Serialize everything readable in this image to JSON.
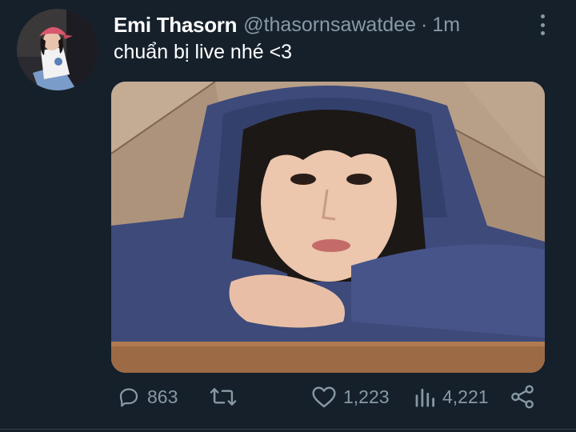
{
  "tweet": {
    "author_name": "Emi Thasorn",
    "handle": "@thasornsawatdee",
    "separator": "·",
    "time": "1m",
    "text": "chuẩn bị live nhé <3"
  },
  "actions": {
    "reply_count": "863",
    "like_count": "1,223",
    "views_count": "4,221"
  },
  "icons": {
    "reply": "reply-icon",
    "retweet": "retweet-icon",
    "like": "heart-icon",
    "views": "bar-chart-icon",
    "share": "share-icon",
    "more": "more-vertical-icon"
  },
  "colors": {
    "background": "#15202b",
    "primary_text": "#ffffff",
    "secondary_text": "#8899a6",
    "divider": "#38444d"
  }
}
